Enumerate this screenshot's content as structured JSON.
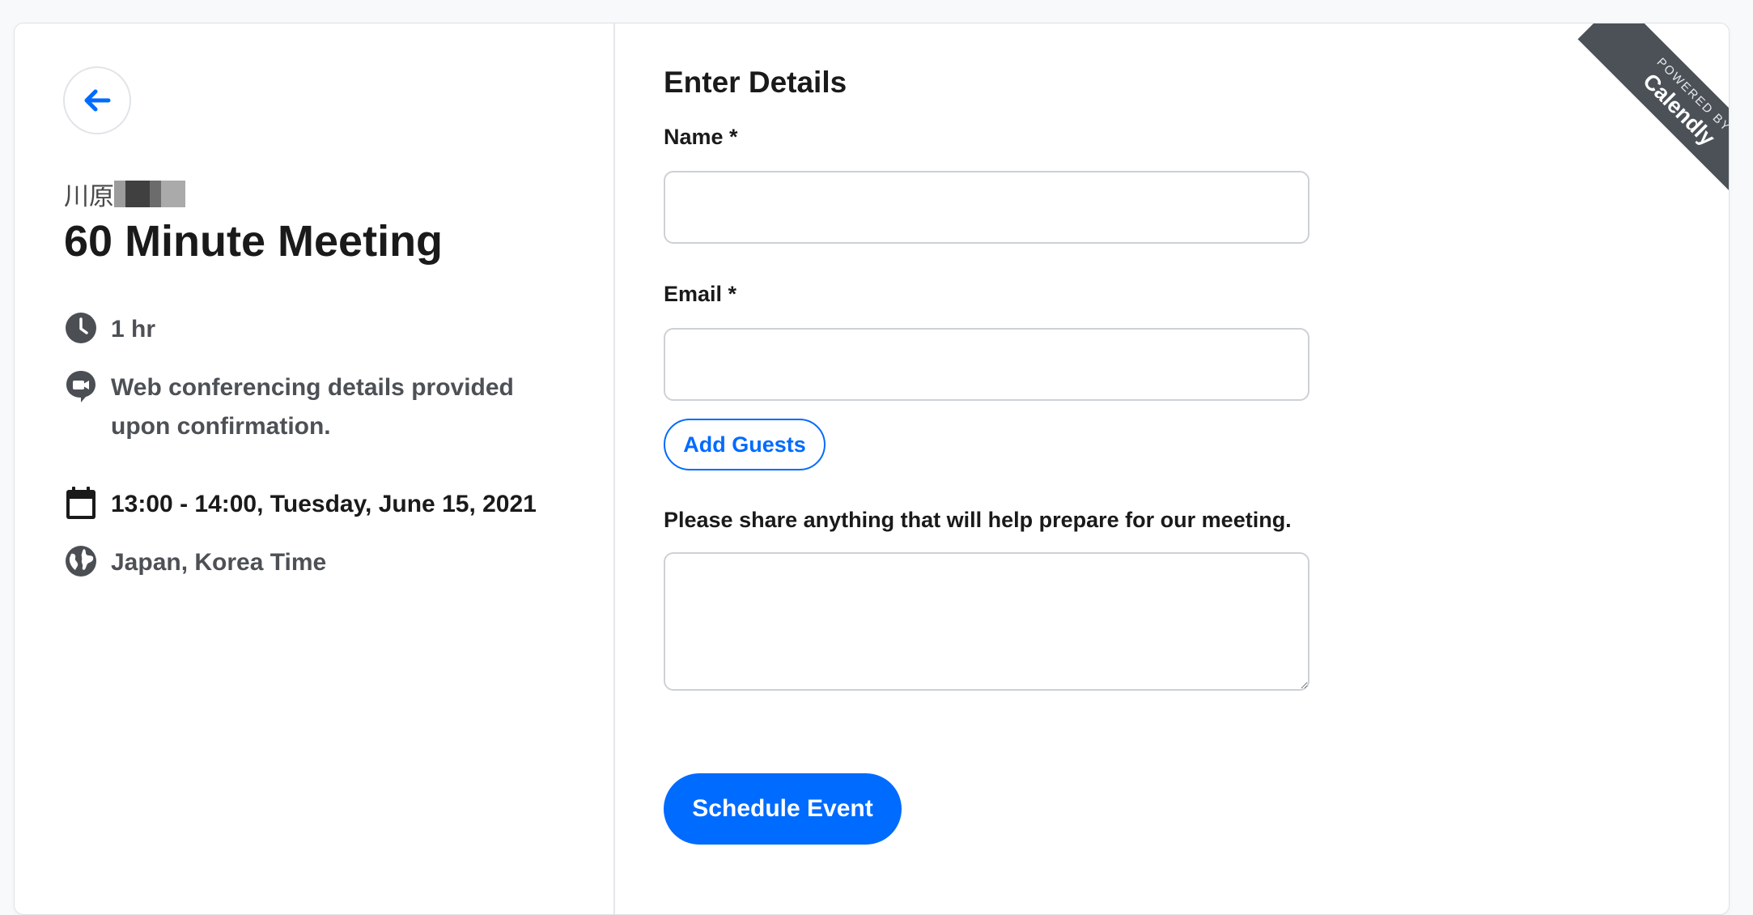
{
  "left_panel": {
    "host_name": "川原",
    "event_title": "60 Minute Meeting",
    "details": {
      "duration": "1 hr",
      "conferencing": "Web conferencing details provided upon confirmation.",
      "datetime": "13:00 - 14:00, Tuesday, June 15, 2021",
      "timezone": "Japan, Korea Time"
    },
    "icons": {
      "back": "arrow-left-icon",
      "duration": "clock-icon",
      "conferencing": "video-chat-icon",
      "datetime": "calendar-icon",
      "timezone": "globe-icon"
    }
  },
  "form": {
    "title": "Enter Details",
    "name_label": "Name *",
    "name_value": "",
    "email_label": "Email *",
    "email_value": "",
    "add_guests_label": "Add Guests",
    "notes_label": "Please share anything that will help prepare for our meeting.",
    "notes_value": "",
    "submit_label": "Schedule Event"
  },
  "badge": {
    "small_text": "POWERED BY",
    "brand_text": "Calendly"
  },
  "colors": {
    "accent": "#006bff",
    "text_primary": "#1a1a1a",
    "text_secondary": "#4d5055",
    "badge_bg": "#4b5157",
    "page_bg": "#f7f9fb"
  }
}
